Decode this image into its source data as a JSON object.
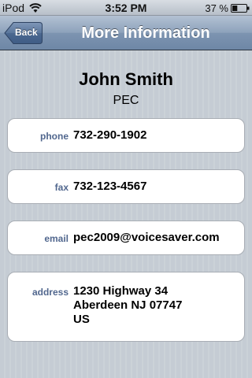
{
  "status_bar": {
    "carrier": "iPod",
    "wifi_icon": "wifi-icon",
    "time": "3:52 PM",
    "battery_percent": "37 %",
    "battery_level": 0.37,
    "battery_icon": "battery-icon"
  },
  "nav": {
    "back_label": "Back",
    "title": "More Information"
  },
  "contact": {
    "name": "John Smith",
    "company": "PEC"
  },
  "fields": {
    "phone": {
      "label": "phone",
      "value": "732-290-1902"
    },
    "fax": {
      "label": "fax",
      "value": "732-123-4567"
    },
    "email": {
      "label": "email",
      "value": "pec2009@voicesaver.com"
    },
    "address": {
      "label": "address",
      "lines": [
        "1230 Highway 34",
        "Aberdeen NJ 07747",
        "US"
      ]
    }
  },
  "colors": {
    "label_blue": "#51678e",
    "nav_bar": "#7d94b1",
    "background": "#c5ccd4"
  }
}
